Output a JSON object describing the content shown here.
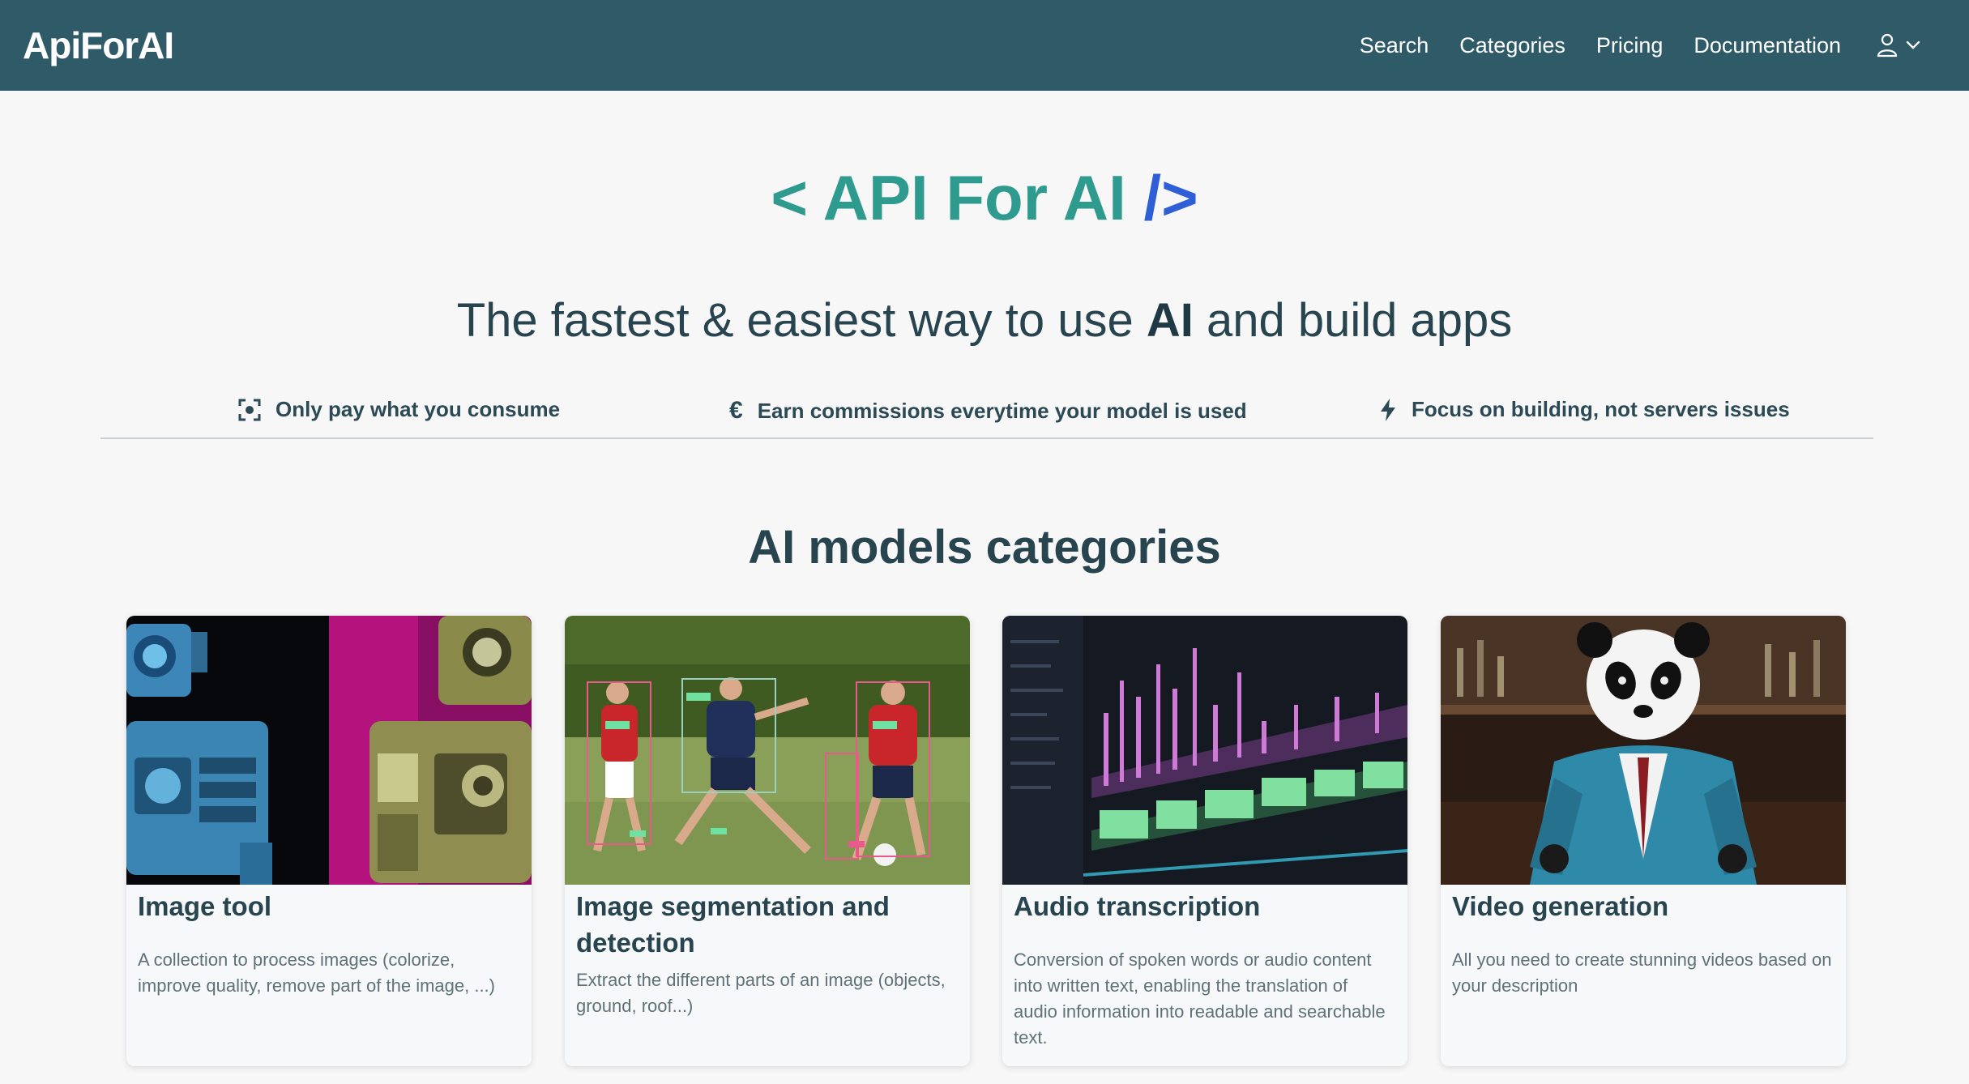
{
  "brand": "ApiForAI",
  "nav": {
    "items": [
      "Search",
      "Categories",
      "Pricing",
      "Documentation"
    ],
    "user_icon": "user-icon",
    "chevron_icon": "chevron-down-icon"
  },
  "hero": {
    "title_open": "< API For AI",
    "title_close": "/>",
    "tagline_before": "The fastest & easiest way to use ",
    "tagline_bold": "AI",
    "tagline_after": " and build apps"
  },
  "features": [
    {
      "icon": "scan-icon",
      "label": "Only pay what you consume"
    },
    {
      "icon": "euro-icon",
      "label": "Earn commissions everytime your model is used"
    },
    {
      "icon": "bolt-icon",
      "label": "Focus on building, not servers issues"
    }
  ],
  "section": {
    "title": "AI models categories"
  },
  "cards": [
    {
      "title": "Image tool",
      "description": "A collection to process images (colorize, improve quality, remove part of the image, ...)"
    },
    {
      "title": "Image segmentation and detection",
      "description": "Extract the different parts of an image (objects, ground, roof...)"
    },
    {
      "title": "Audio transcription",
      "description": "Conversion of spoken words or audio content into written text, enabling the translation of audio information into readable and searchable text."
    },
    {
      "title": "Video generation",
      "description": "All you need to create stunning videos based on your description"
    }
  ],
  "colors": {
    "navbar": "#2f5a68",
    "accent_teal": "#2f9a8e",
    "accent_blue": "#2f5fd6",
    "text_dark": "#27444f"
  }
}
